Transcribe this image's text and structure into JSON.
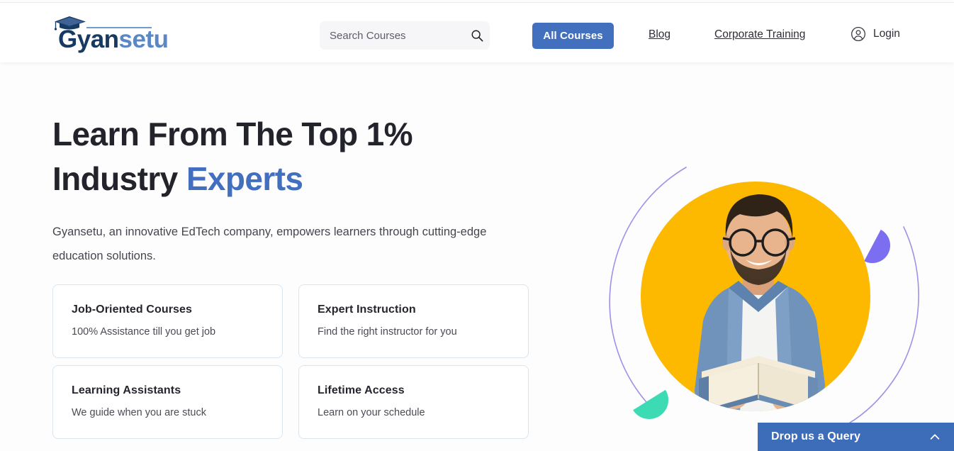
{
  "brand": {
    "name_part1": "Gyan",
    "name_part2": "setu",
    "logo_icon": "graduation-cap-icon"
  },
  "header": {
    "search": {
      "placeholder": "Search Courses",
      "value": "",
      "icon": "search-icon"
    },
    "all_courses_label": "All Courses",
    "nav": [
      {
        "label": "Blog"
      },
      {
        "label": "Corporate Training"
      }
    ],
    "login": {
      "label": "Login",
      "icon": "user-circle-icon"
    }
  },
  "hero": {
    "title_line1": "Learn From The Top 1%",
    "title_line2_prefix": "Industry ",
    "title_line2_accent": "Experts",
    "subtitle": "Gyansetu, an innovative EdTech company, empowers learners through cutting-edge education solutions.",
    "image_alt": "man-reading-book-photo"
  },
  "cards": [
    {
      "title": "Job-Oriented Courses",
      "desc": "100% Assistance till you get job"
    },
    {
      "title": "Expert Instruction",
      "desc": "Find the right instructor for you"
    },
    {
      "title": "Learning Assistants",
      "desc": "We guide when you are stuck"
    },
    {
      "title": "Lifetime Access",
      "desc": "Learn on your schedule"
    }
  ],
  "query_widget": {
    "label": "Drop us a Query",
    "icon": "chevron-up-icon"
  },
  "colors": {
    "accent_blue": "#4270bf",
    "widget_blue": "#3d6cb9",
    "hero_circle_yellow": "#fcb900",
    "decor_purple": "#7b6ef0",
    "decor_teal": "#3ddbb4",
    "arc_purple": "#9b93e8",
    "card_border": "#d9e5ef",
    "page_background": "#fdfdfe",
    "logo_dark": "#173a63",
    "logo_mid": "#5b87c4"
  }
}
